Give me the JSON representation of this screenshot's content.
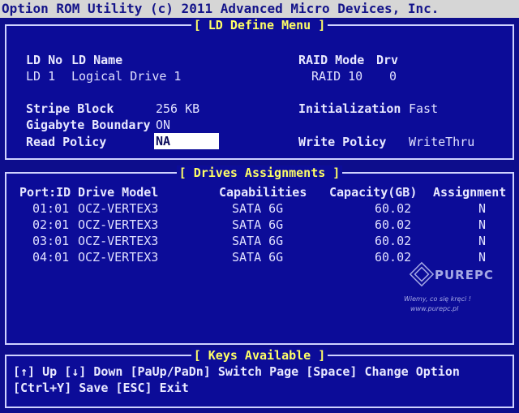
{
  "window": {
    "title": "Option ROM Utility (c) 2011 Advanced Micro Devices, Inc."
  },
  "ld_define": {
    "panel_title": "[ LD Define Menu ]",
    "headers": {
      "ld_no": "LD No",
      "ld_name": "LD Name",
      "raid_mode": "RAID Mode",
      "drv": "Drv"
    },
    "row": {
      "ld_no": "LD  1",
      "ld_name": "Logical Drive 1",
      "raid_mode": "RAID 10",
      "drv": "0"
    },
    "stripe_block_label": "Stripe Block",
    "stripe_block_value": "256 KB",
    "gigabyte_boundary_label": "Gigabyte Boundary",
    "gigabyte_boundary_value": "ON",
    "read_policy_label": "Read Policy",
    "read_policy_value": "NA",
    "initialization_label": "Initialization",
    "initialization_value": "Fast",
    "write_policy_label": "Write Policy",
    "write_policy_value": "WriteThru"
  },
  "drives": {
    "panel_title": "[ Drives Assignments ]",
    "columns": [
      "Port:ID",
      "Drive Model",
      "Capabilities",
      "Capacity(GB)",
      "Assignment"
    ],
    "rows": [
      [
        "01:01",
        "OCZ-VERTEX3",
        "SATA 6G",
        "60.02",
        "N"
      ],
      [
        "02:01",
        "OCZ-VERTEX3",
        "SATA 6G",
        "60.02",
        "N"
      ],
      [
        "03:01",
        "OCZ-VERTEX3",
        "SATA 6G",
        "60.02",
        "N"
      ],
      [
        "04:01",
        "OCZ-VERTEX3",
        "SATA 6G",
        "60.02",
        "N"
      ]
    ]
  },
  "keys": {
    "panel_title": "[ Keys Available ]",
    "line1": "[↑] Up  [↓] Down  [PaUp/PaDn] Switch Page  [Space] Change Option",
    "line2": "[Ctrl+Y] Save  [ESC] Exit"
  },
  "watermark": {
    "logo_text": "PUREPC",
    "tagline": "Wiemy, co się kręci !",
    "site": "www.purepc.pl"
  }
}
